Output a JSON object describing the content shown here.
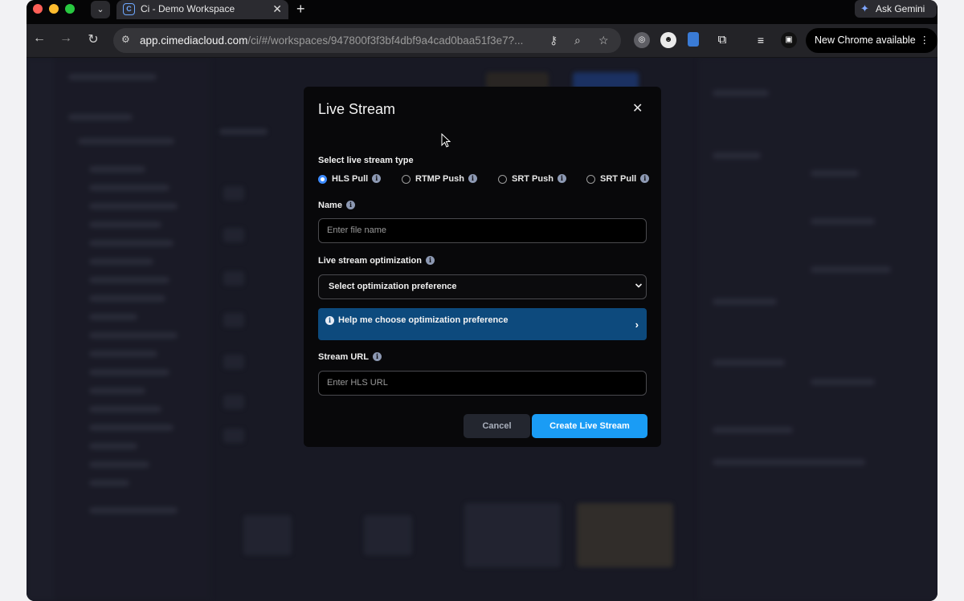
{
  "browser": {
    "tab_title": "Ci - Demo Workspace",
    "tab_favicon_letter": "C",
    "url_host": "app.cimediacloud.com",
    "url_path": "/ci/#/workspaces/947800f3f3bf4dbf9a4cad0baa51f3e7?...",
    "ask_gemini_label": "Ask Gemini",
    "update_label": "New Chrome available"
  },
  "modal": {
    "title": "Live Stream",
    "type_label": "Select live stream type",
    "stream_types": [
      {
        "label": "HLS Pull",
        "selected": true
      },
      {
        "label": "RTMP Push",
        "selected": false
      },
      {
        "label": "SRT Push",
        "selected": false
      },
      {
        "label": "SRT Pull",
        "selected": false
      }
    ],
    "name_label": "Name",
    "name_placeholder": "Enter file name",
    "optimization_label": "Live stream optimization",
    "optimization_value": "Select optimization preference",
    "help_text": "Help me choose optimization preference",
    "stream_url_label": "Stream URL",
    "stream_url_placeholder": "Enter HLS URL",
    "cancel_label": "Cancel",
    "create_label": "Create Live Stream"
  },
  "colors": {
    "accent": "#1a9cf5",
    "help_bg": "#0d4a7d",
    "radio_selected": "#3d8bff"
  }
}
